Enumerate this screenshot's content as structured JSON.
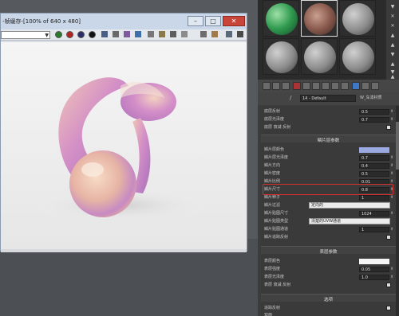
{
  "render_window": {
    "title": "-帧缓存-[100% of 640 x 480]",
    "buttons": {
      "minimize": "–",
      "maximize": "□",
      "close": "✕"
    }
  },
  "material_editor": {
    "material_name": "14 - Default",
    "material_type": "W_车漆材质",
    "type_prefix": "/",
    "column_icons": [
      "▼",
      "✕",
      "✕",
      "▲",
      "▲",
      "▼",
      "▲",
      "▼",
      "▲"
    ]
  },
  "rollout": {
    "base": [
      {
        "label": "底层反射",
        "value": "0.5"
      },
      {
        "label": "底层光泽度",
        "value": "0.7"
      },
      {
        "label": "底层 衰减 反射",
        "value": ""
      }
    ],
    "flake_header": "鳞片层参数",
    "flake": [
      {
        "label": "鳞片层颜色",
        "value": ""
      },
      {
        "label": "鳞片层光泽度",
        "value": "0.7"
      },
      {
        "label": "鳞片方向",
        "value": "0.4"
      },
      {
        "label": "鳞片密度",
        "value": "0.5"
      },
      {
        "label": "鳞片比例",
        "value": "0.01"
      },
      {
        "label": "鳞片尺寸",
        "value": "0.8"
      },
      {
        "label": "鳞片种子",
        "value": "1"
      }
    ],
    "flake_filter": {
      "label": "鳞片过滤",
      "value": "定向的"
    },
    "flake_map_size": {
      "label": "鳞片贴图尺寸",
      "value": "1024"
    },
    "flake_map_type": {
      "label": "鳞片贴图类型",
      "value": "清楚的UVW通道"
    },
    "flake_map_channel": {
      "label": "鳞片贴图通道",
      "value": "1"
    },
    "flake_trace": {
      "label": "鳞片追踪反射",
      "value": ""
    },
    "coat_header": "表层参数",
    "coat": [
      {
        "label": "表层颜色",
        "value": ""
      },
      {
        "label": "表层强度",
        "value": "0.05"
      },
      {
        "label": "表层光泽度",
        "value": "1.0"
      },
      {
        "label": "表层 衰减 反射",
        "value": ""
      }
    ],
    "options_header": "选项",
    "options": [
      {
        "label": "追踪反射",
        "value": ""
      },
      {
        "label": "双面",
        "value": ""
      }
    ]
  },
  "colors": {
    "flake_color": "#9aa9e0",
    "coat_color": "#f5f5f5",
    "highlight": "#d43030"
  }
}
